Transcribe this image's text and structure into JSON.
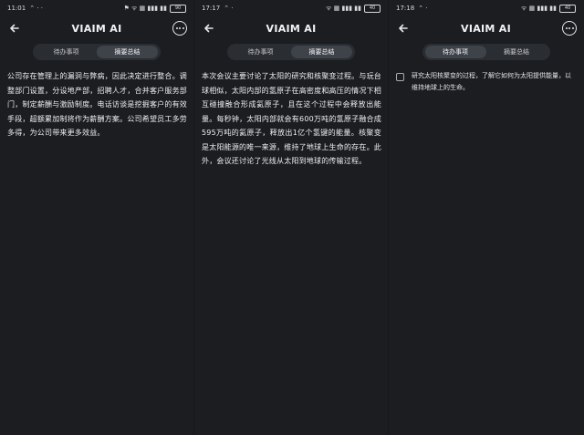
{
  "screens": [
    {
      "status_time": "11:01",
      "status_symbols": "⌃ · ·",
      "status_icons": "⚑ ᯤ ▦ ▮▮▮ ▮▮",
      "battery": "90",
      "title": "VIAIM AI",
      "tabs": [
        {
          "label": "待办事项",
          "active": false
        },
        {
          "label": "摘要总结",
          "active": true
        }
      ],
      "content": "公司存在管理上的漏洞与弊病，因此决定进行整合。调整部门设置，分设地产部，招聘人才，合并客户服务部门，制定薪酬与激励制度。电话访谈是挖掘客户的有效手段，超额累加制将作为薪酬方案。公司希望员工多劳多得，为公司带来更多效益。"
    },
    {
      "status_time": "17:17",
      "status_symbols": "⌃ ·",
      "status_icons": "ᯤ ▦ ▮▮▮ ▮▮",
      "battery": "40",
      "title": "VIAIM AI",
      "tabs": [
        {
          "label": "待办事项",
          "active": false
        },
        {
          "label": "摘要总结",
          "active": true
        }
      ],
      "content": "本次会议主要讨论了太阳的研究和核聚变过程。与玩台球相似，太阳内部的氢原子在高密度和高压的情况下相互碰撞融合形成氦原子，且在这个过程中会释放出能量。每秒钟，太阳内部就会有600万吨的氢原子融合成595万吨的氦原子，释放出1亿个氢键的能量。核聚变是太阳能源的唯一来源，维持了地球上生命的存在。此外，会议还讨论了光线从太阳到地球的传输过程。"
    },
    {
      "status_time": "17:18",
      "status_symbols": "⌃ ·",
      "status_icons": "ᯤ ▦ ▮▮▮ ▮▮",
      "battery": "40",
      "title": "VIAIM AI",
      "tabs": [
        {
          "label": "待办事项",
          "active": true
        },
        {
          "label": "摘要总结",
          "active": false
        }
      ],
      "todo": {
        "checked": false,
        "text": "研究太阳核聚变的过程，了解它如何为太阳提供能量，以维持地球上的生命。"
      }
    }
  ]
}
